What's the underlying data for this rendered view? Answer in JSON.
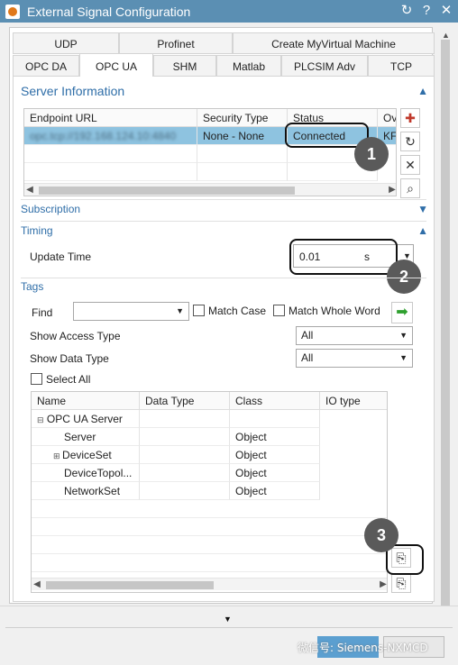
{
  "window": {
    "title": "External Signal Configuration",
    "buttons": {
      "refresh": "↻",
      "help": "?",
      "close": "✕"
    }
  },
  "tabs": {
    "row1": [
      "UDP",
      "Profinet",
      "Create MyVirtual Machine"
    ],
    "row2": [
      "OPC DA",
      "OPC UA",
      "SHM",
      "Matlab",
      "PLCSIM Adv",
      "TCP"
    ]
  },
  "server_info": {
    "title": "Server Information",
    "columns": [
      "Endpoint URL",
      "Security Type",
      "Status",
      "Ov"
    ],
    "row": {
      "endpoint": "opc.tcp://192.168.124.10:4840",
      "security": "None - None",
      "status": "Connected",
      "ov": "KF"
    }
  },
  "subscription": {
    "title": "Subscription"
  },
  "timing": {
    "title": "Timing",
    "update_time_label": "Update Time",
    "update_time_value": "0.01",
    "unit": "s"
  },
  "tags": {
    "title": "Tags",
    "find_label": "Find",
    "find_value": "",
    "match_case_label": "Match Case",
    "match_whole_word_label": "Match Whole Word",
    "show_access_type_label": "Show Access Type",
    "show_access_type_value": "All",
    "show_data_type_label": "Show Data Type",
    "show_data_type_value": "All",
    "select_all_label": "Select All",
    "columns": [
      "Name",
      "Data Type",
      "Class",
      "IO type"
    ],
    "root": "OPC UA Server",
    "rows": [
      {
        "name": "Server",
        "class": "Object"
      },
      {
        "name": "DeviceSet",
        "class": "Object"
      },
      {
        "name": "DeviceTopol...",
        "class": "Object"
      },
      {
        "name": "NetworkSet",
        "class": "Object"
      }
    ]
  },
  "badges": [
    "1",
    "2",
    "3"
  ],
  "watermark": "微信号: Siemens-NXMCD",
  "colors": {
    "titlebar": "#5b8fb3",
    "accent": "#2f6ea8",
    "selected_row": "#8ec3e0"
  }
}
